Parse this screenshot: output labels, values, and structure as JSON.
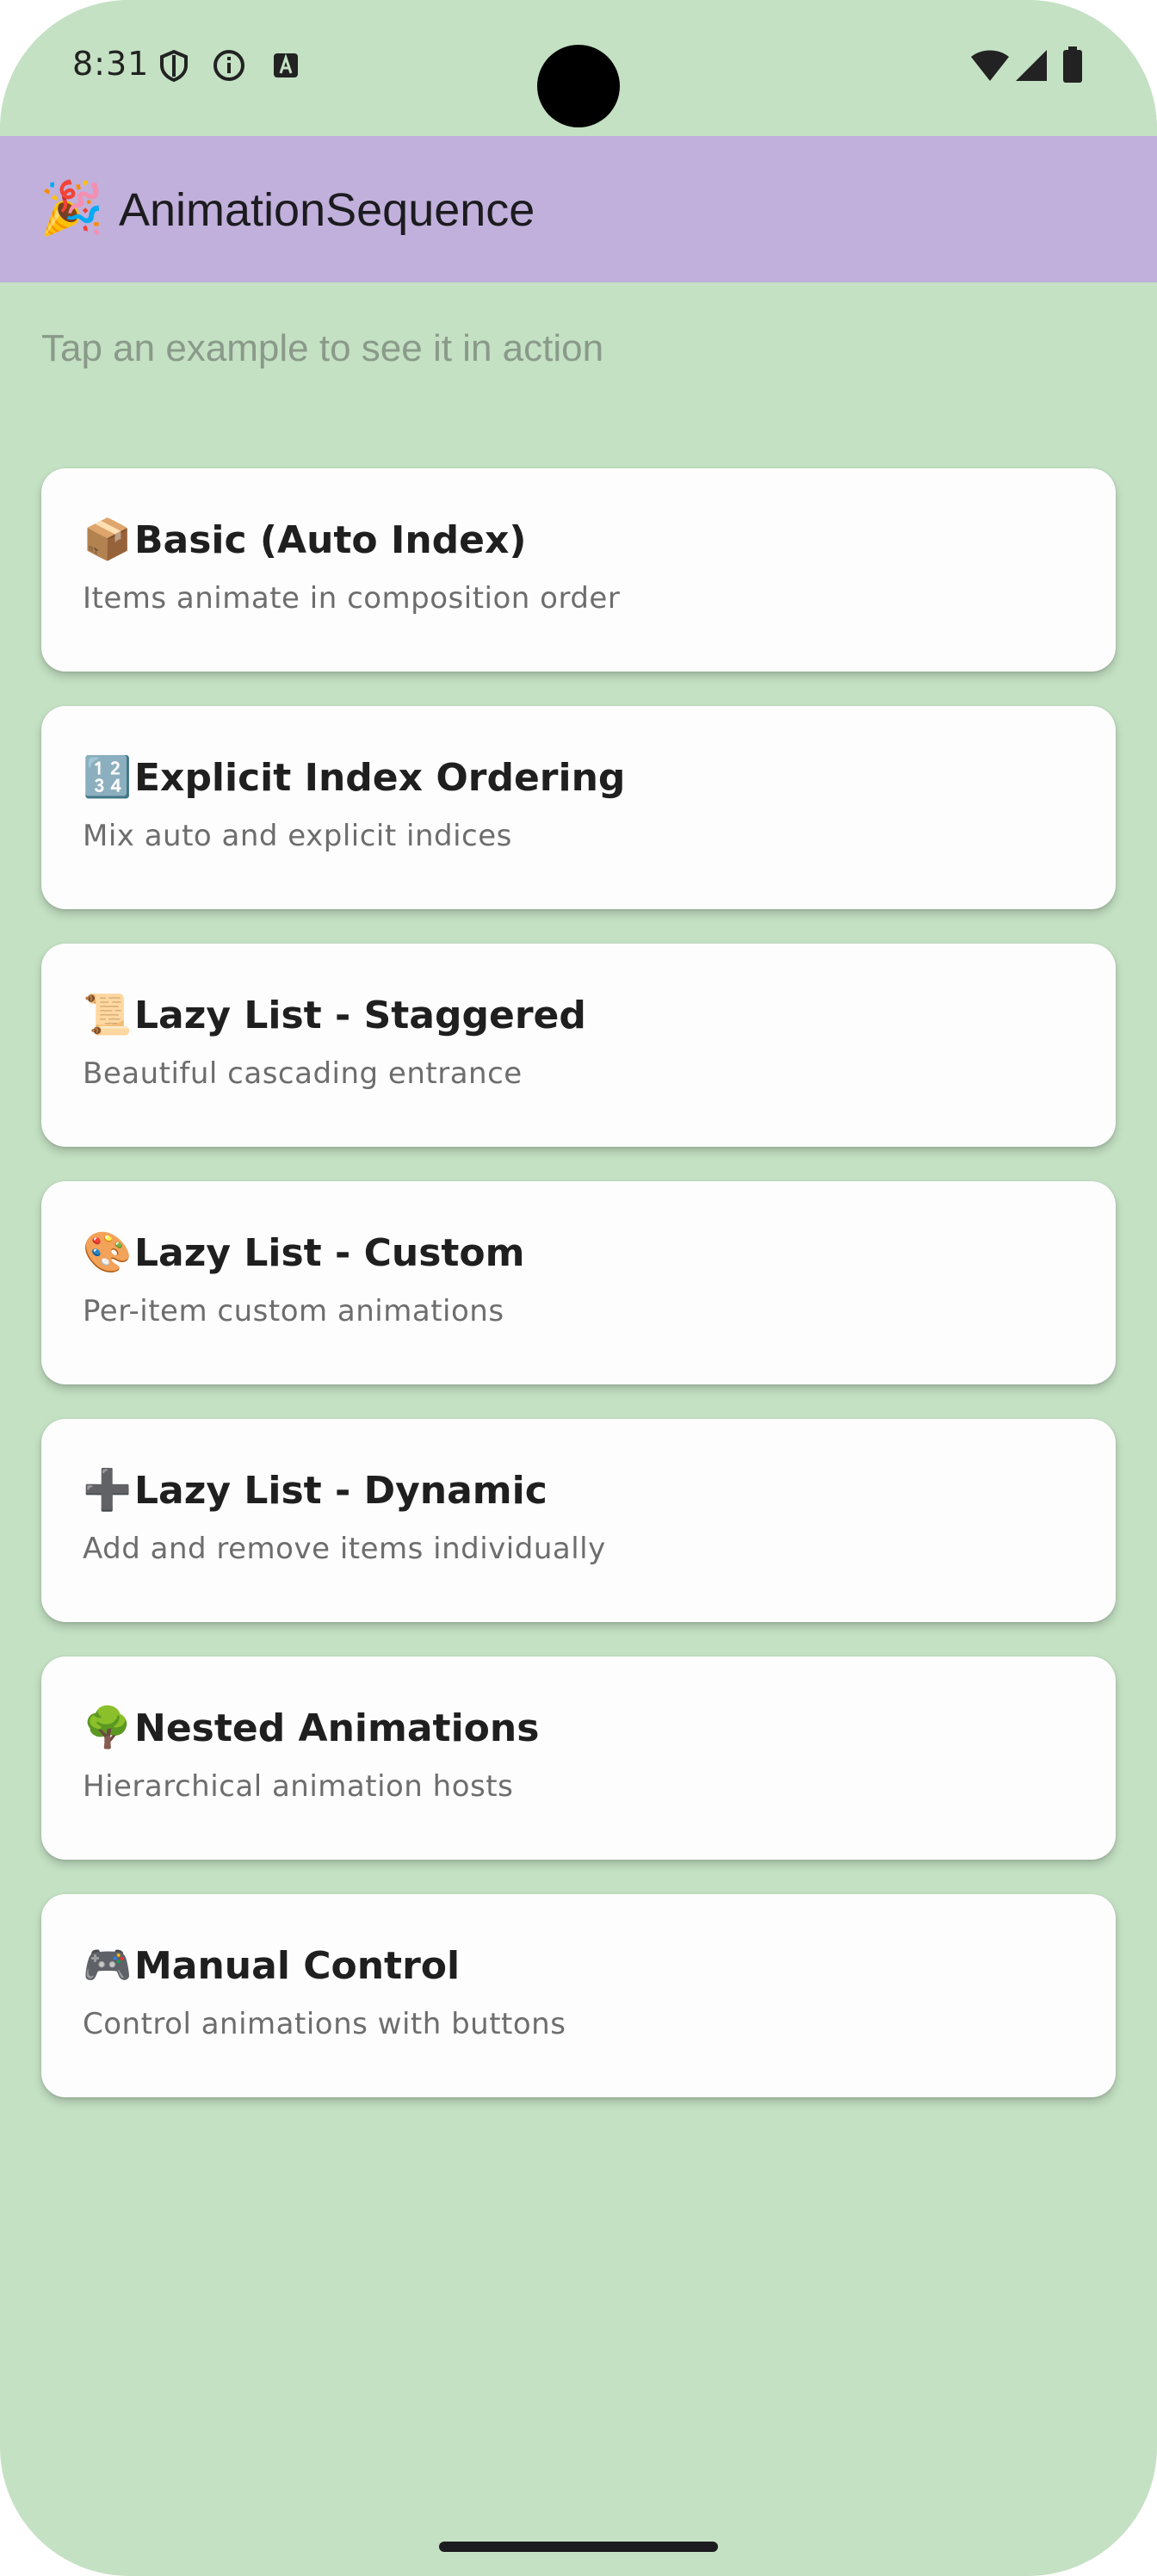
{
  "status_bar": {
    "time": "8:31",
    "left_icons": [
      "shield-icon",
      "info-icon",
      "a-badge-icon"
    ],
    "right_icons": [
      "wifi-icon",
      "signal-icon",
      "battery-icon"
    ]
  },
  "app_bar": {
    "emoji": "🎉",
    "title": "AnimationSequence",
    "color": "#c0b0db"
  },
  "subtitle": "Tap an example to see it in action",
  "examples": [
    {
      "emoji": "📦",
      "title": "Basic (Auto Index)",
      "description": "Items animate in composition order"
    },
    {
      "emoji": "🔢",
      "title": "Explicit Index Ordering",
      "description": "Mix auto and explicit indices"
    },
    {
      "emoji": "📜",
      "title": "Lazy List - Staggered",
      "description": "Beautiful cascading entrance"
    },
    {
      "emoji": "🎨",
      "title": "Lazy List - Custom",
      "description": "Per-item custom animations"
    },
    {
      "emoji": "➕",
      "title": "Lazy List - Dynamic",
      "description": "Add and remove items individually"
    },
    {
      "emoji": "🌳",
      "title": "Nested Animations",
      "description": "Hierarchical animation hosts"
    },
    {
      "emoji": "🎮",
      "title": "Manual Control",
      "description": "Control animations with buttons"
    }
  ],
  "colors": {
    "background": "#c4e1c3",
    "card": "#fdfdfd"
  }
}
